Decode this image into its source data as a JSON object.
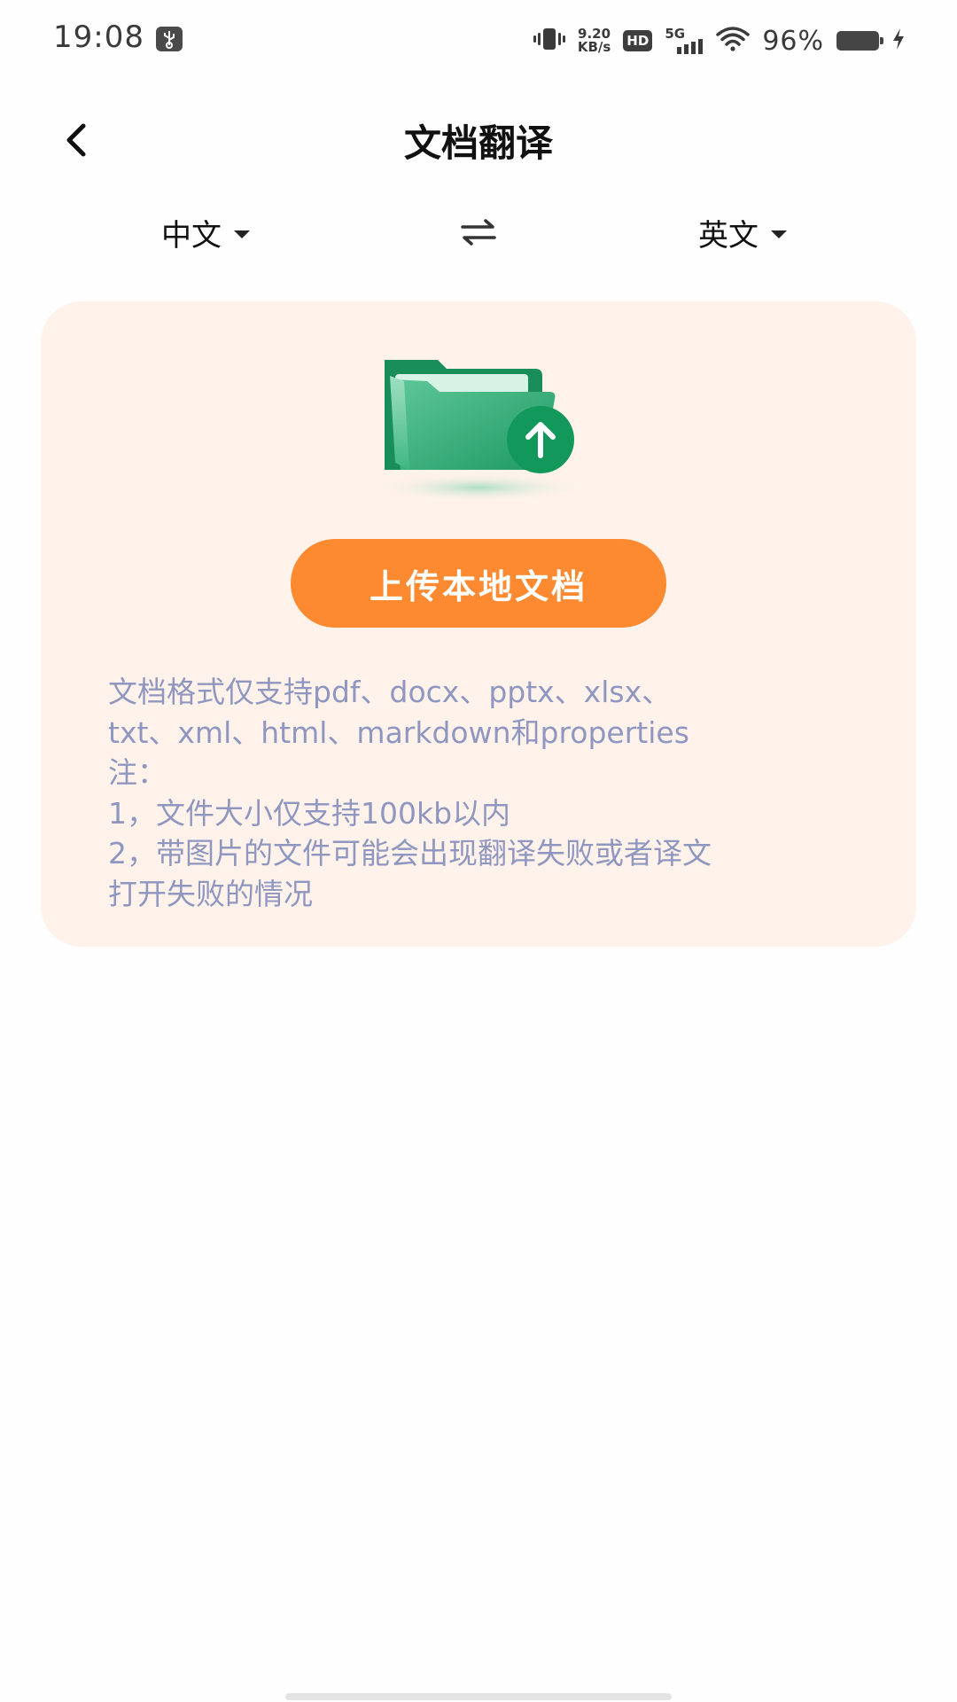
{
  "status_bar": {
    "time": "19:08",
    "net_speed_value": "9.20",
    "net_speed_unit": "KB/s",
    "hd_label": "HD",
    "network_label": "5G",
    "battery_percent": "96%",
    "icons": [
      "usb-debug-icon",
      "vibrate-icon",
      "hd-icon",
      "signal-5g-icon",
      "wifi-icon",
      "battery-icon",
      "charging-icon"
    ]
  },
  "header": {
    "title": "文档翻译",
    "back_icon": "chevron-left-icon"
  },
  "language": {
    "source": "中文",
    "target": "英文",
    "swap_icon": "swap-arrows-icon",
    "dropdown_icon": "caret-down-icon"
  },
  "upload_card": {
    "icon": "folder-upload-icon",
    "button_label": "上传本地文档",
    "notes": [
      "文档格式仅支持pdf、docx、pptx、xlsx、",
      "txt、xml、html、markdown和properties",
      "注：",
      "1，文件大小仅支持100kb以内",
      "2，带图片的文件可能会出现翻译失败或者译文",
      "打开失败的情况"
    ]
  },
  "colors": {
    "accent": "#fd8a30",
    "card_background": "#fef2ea",
    "note_text": "#8f97c0",
    "folder_green": "#1f9a63"
  }
}
